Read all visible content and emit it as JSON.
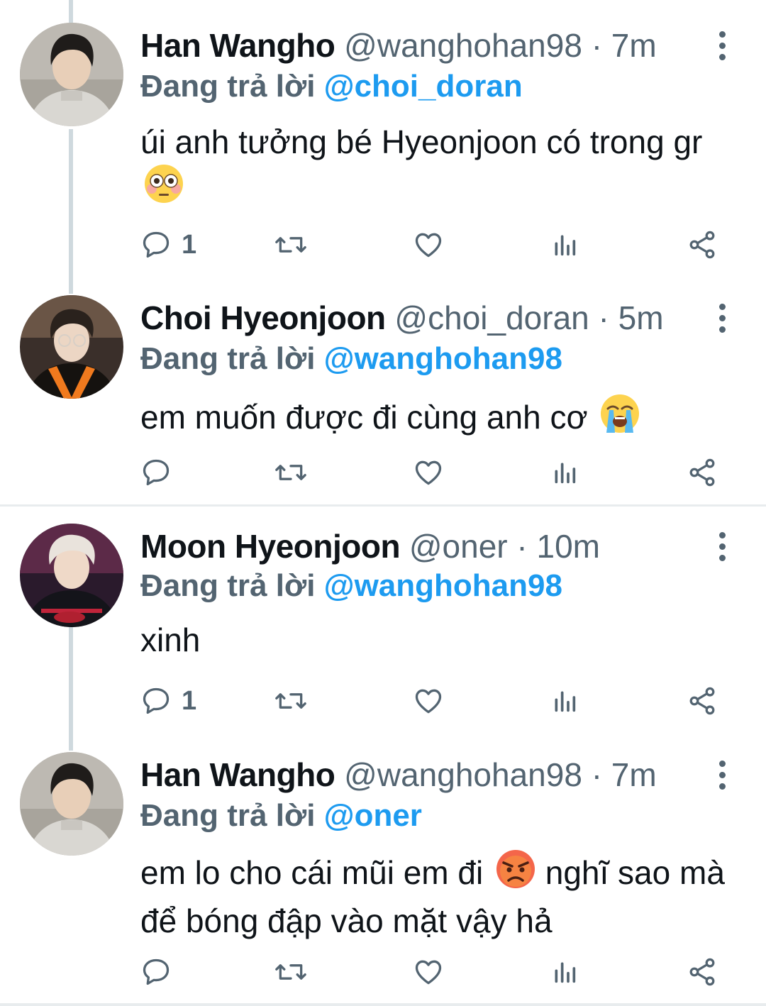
{
  "colors": {
    "link": "#1d9bf0",
    "secondary": "#536471",
    "text": "#0f1419",
    "thread": "#cfd9de"
  },
  "tweets": [
    {
      "name": "Han Wangho",
      "handle": "@wanghohan98",
      "dot": "·",
      "time": "7m",
      "reply_label": "Đang trả lời",
      "reply_to": "@choi_doran",
      "text_before": "úi anh tưởng bé Hyeonjoon có trong gr",
      "emoji": "flushed-face",
      "text_after": "",
      "reply_count": "1"
    },
    {
      "name": "Choi Hyeonjoon",
      "handle": "@choi_doran",
      "dot": "·",
      "time": "5m",
      "reply_label": "Đang trả lời",
      "reply_to": "@wanghohan98",
      "text_before": "em muốn được đi cùng anh cơ",
      "emoji": "loudly-crying-face",
      "text_after": "",
      "reply_count": ""
    },
    {
      "name": "Moon Hyeonjoon",
      "handle": "@oner",
      "dot": "·",
      "time": "10m",
      "reply_label": "Đang trả lời",
      "reply_to": "@wanghohan98",
      "text_before": "xinh",
      "emoji": "",
      "text_after": "",
      "reply_count": "1"
    },
    {
      "name": "Han Wangho",
      "handle": "@wanghohan98",
      "dot": "·",
      "time": "7m",
      "reply_label": "Đang trả lời",
      "reply_to": "@oner",
      "text_before": "em lo cho cái mũi em đi",
      "emoji": "angry-face",
      "text_after": "nghĩ sao mà để bóng đập vào mặt vậy hả",
      "reply_count": ""
    }
  ]
}
